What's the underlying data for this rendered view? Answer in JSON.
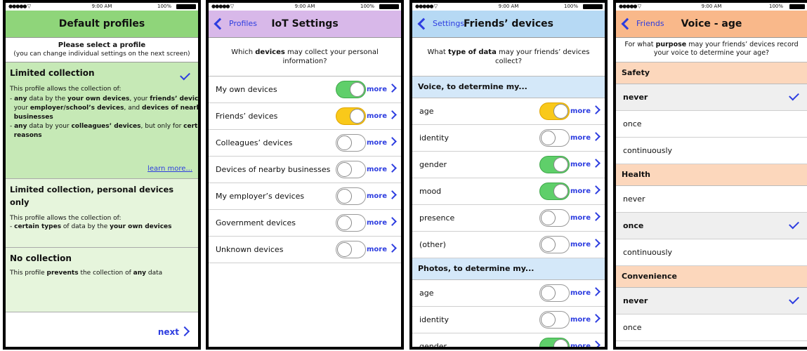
{
  "status": {
    "signal": "●●●●● ▽",
    "time": "9:00 AM",
    "battery": "100%"
  },
  "colors": {
    "green_header": "#8fd57a",
    "green_selected": "#c6e9b6",
    "green_light": "#e6f5dc",
    "purple_header": "#d8b8e9",
    "blue_header": "#b6d9f4",
    "blue_section": "#d4e8f9",
    "orange_header": "#f9b88a",
    "orange_section": "#fcd7bc",
    "accent": "#2d3de0"
  },
  "panel1": {
    "title": "Default profiles",
    "intro_title": "Please select a profile",
    "intro_sub": "(you can change individual settings on the next screen)",
    "profiles": [
      {
        "title": "Limited collection",
        "desc_intro": "This profile allows the collection of:",
        "lines": [
          [
            "- ",
            "any",
            " data by the ",
            "your own devices",
            ", your ",
            "friends’ devices",
            ","
          ],
          [
            "  your ",
            "employer/school’s devices",
            ", and ",
            "devices of nearby"
          ],
          [
            "  ",
            "businesses",
            "",
            "",
            "",
            "",
            ""
          ],
          [
            "- ",
            "any",
            " data by your ",
            "colleagues’ devices",
            ", but only for ",
            "certain",
            ""
          ],
          [
            "  ",
            "reasons",
            "",
            "",
            "",
            "",
            ""
          ]
        ],
        "link": "learn more..."
      },
      {
        "title": "Limited collection, personal devices only",
        "desc_intro": "This profile allows the collection of:",
        "lines": [
          [
            "- ",
            "certain types",
            " of data by the ",
            "your own devices",
            "",
            "",
            ""
          ]
        ]
      },
      {
        "title": "No collection",
        "desc_pre": "This profile ",
        "desc_b1": "prevents",
        "desc_mid": " the collection of ",
        "desc_b2": "any",
        "desc_post": " data"
      }
    ],
    "next": "next"
  },
  "panel2": {
    "back": "Profiles",
    "title": "IoT Settings",
    "q_pre": "Which ",
    "q_bold": "devices",
    "q_post": " may collect your personal information?",
    "more": "more",
    "rows": [
      {
        "label": "My own devices",
        "state": "on-green"
      },
      {
        "label": "Friends’ devices",
        "state": "on-yellow"
      },
      {
        "label": "Colleagues’ devices",
        "state": "off"
      },
      {
        "label": "Devices of nearby businesses",
        "state": "off"
      },
      {
        "label": "My employer’s devices",
        "state": "off"
      },
      {
        "label": "Government devices",
        "state": "off"
      },
      {
        "label": "Unknown devices",
        "state": "off"
      }
    ]
  },
  "panel3": {
    "back": "Settings",
    "title": "Friends’ devices",
    "q_pre": "What ",
    "q_bold": "type of data",
    "q_post": " may your friends’ devices collect?",
    "more": "more",
    "sections": [
      {
        "header": "Voice, to determine my...",
        "rows": [
          {
            "label": "age",
            "state": "on-yellow"
          },
          {
            "label": "identity",
            "state": "off"
          },
          {
            "label": "gender",
            "state": "on-green"
          },
          {
            "label": "mood",
            "state": "on-green"
          },
          {
            "label": "presence",
            "state": "off"
          },
          {
            "label": "(other)",
            "state": "off"
          }
        ]
      },
      {
        "header": "Photos, to determine my...",
        "rows": [
          {
            "label": "age",
            "state": "off"
          },
          {
            "label": "identity",
            "state": "off"
          },
          {
            "label": "gender",
            "state": "on-green"
          }
        ]
      }
    ]
  },
  "panel4": {
    "back": "Friends",
    "title": "Voice - age",
    "q_pre": "For what ",
    "q_bold": "purpose",
    "q_post": " may your friends’ devices record your voice to determine your age?",
    "sections": [
      {
        "header": "Safety",
        "options": [
          {
            "label": "never",
            "selected": true
          },
          {
            "label": "once",
            "selected": false
          },
          {
            "label": "continuously",
            "selected": false
          }
        ]
      },
      {
        "header": "Health",
        "options": [
          {
            "label": "never",
            "selected": false
          },
          {
            "label": "once",
            "selected": true
          },
          {
            "label": "continuously",
            "selected": false
          }
        ]
      },
      {
        "header": "Convenience",
        "options": [
          {
            "label": "never",
            "selected": true
          },
          {
            "label": "once",
            "selected": false
          }
        ]
      }
    ]
  }
}
